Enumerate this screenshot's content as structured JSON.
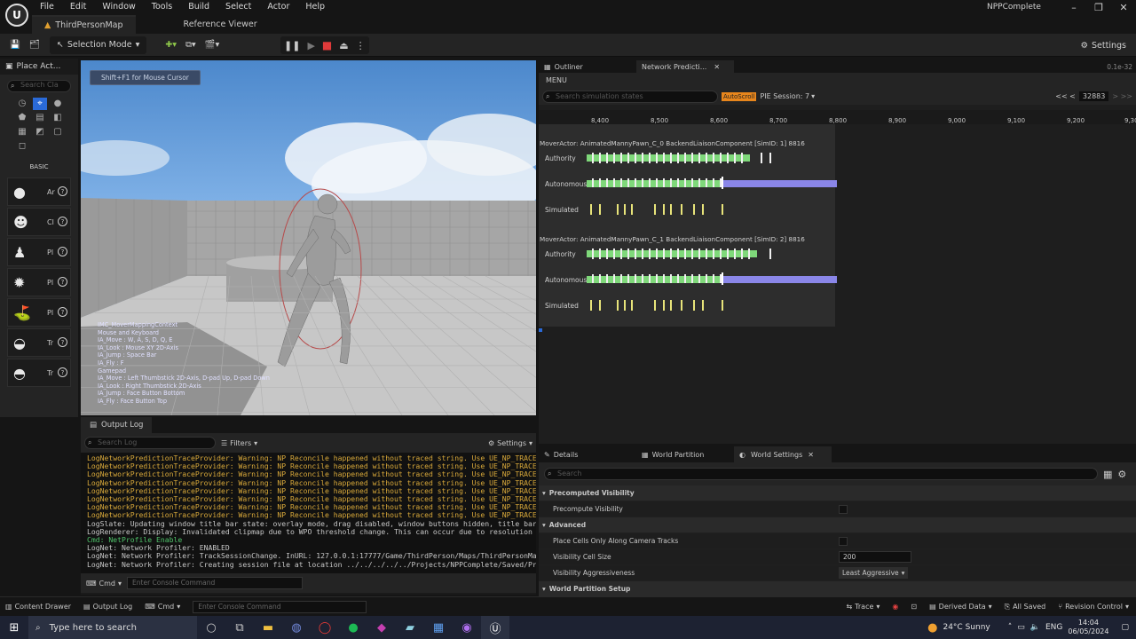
{
  "menu": [
    "File",
    "Edit",
    "Window",
    "Tools",
    "Build",
    "Select",
    "Actor",
    "Help"
  ],
  "project_name": "NPPComplete",
  "tabs": [
    "ThirdPersonMap",
    "Reference Viewer"
  ],
  "toolbar": {
    "selection_mode": "Selection Mode",
    "settings": "Settings"
  },
  "left_panel": {
    "title": "Place Act...",
    "search_placeholder": "Search Cla",
    "section": "BASIC",
    "items": [
      "Ar",
      "Cl",
      "Pl",
      "Pl",
      "Pl",
      "Tr",
      "Tr"
    ]
  },
  "viewport": {
    "hint": "Shift+F1 for Mouse Cursor",
    "overlay_lines": [
      "IMC_MoverMappingContext",
      "Mouse and Keyboard",
      "IA_Move : W, A, S, D, Q, E",
      "IA_Look : Mouse XY 2D-Axis",
      "IA_Jump : Space Bar",
      "IA_Fly : F",
      "Gamepad",
      "IA_Move : Left Thumbstick 2D-Axis, D-pad Up, D-pad Down",
      "IA_Look : Right Thumbstick 2D-Axis",
      "IA_Jump : Face Button Bottom",
      "IA_Fly : Face Button Top"
    ]
  },
  "output_log": {
    "title": "Output Log",
    "search_placeholder": "Search Log",
    "filters": "Filters",
    "settings": "Settings",
    "lines": [
      {
        "text": "LogNetworkPredictionTraceProvider: Warning: NP Reconcile happened without traced string. Use UE_NP_TRACE_",
        "color": "#d9a93a"
      },
      {
        "text": "LogNetworkPredictionTraceProvider: Warning: NP Reconcile happened without traced string. Use UE_NP_TRACE_",
        "color": "#d9a93a"
      },
      {
        "text": "LogNetworkPredictionTraceProvider: Warning: NP Reconcile happened without traced string. Use UE_NP_TRACE_",
        "color": "#d9a93a"
      },
      {
        "text": "LogNetworkPredictionTraceProvider: Warning: NP Reconcile happened without traced string. Use UE_NP_TRACE_",
        "color": "#d9a93a"
      },
      {
        "text": "LogNetworkPredictionTraceProvider: Warning: NP Reconcile happened without traced string. Use UE_NP_TRACE_",
        "color": "#d9a93a"
      },
      {
        "text": "LogNetworkPredictionTraceProvider: Warning: NP Reconcile happened without traced string. Use UE_NP_TRACE_",
        "color": "#d9a93a"
      },
      {
        "text": "LogNetworkPredictionTraceProvider: Warning: NP Reconcile happened without traced string. Use UE_NP_TRACE_",
        "color": "#d9a93a"
      },
      {
        "text": "LogNetworkPredictionTraceProvider: Warning: NP Reconcile happened without traced string. Use UE_NP_TRACE_",
        "color": "#d9a93a"
      },
      {
        "text": "LogSlate: Updating window title bar state: overlay mode, drag disabled, window buttons hidden, title bar",
        "color": "#c8c8c8"
      },
      {
        "text": "LogRenderer: Display: Invalidated clipmap due to WPO threshold change. This can occur due to resolution o",
        "color": "#c8c8c8"
      },
      {
        "text": "Cmd: NetProfile Enable",
        "color": "#4fc36a"
      },
      {
        "text": "LogNet: Network Profiler: ENABLED",
        "color": "#c8c8c8"
      },
      {
        "text": "LogNet: Network Profiler: TrackSessionChange.  InURL: 127.0.0.1:17777/Game/ThirdPerson/Maps/ThirdPersonMa",
        "color": "#c8c8c8"
      },
      {
        "text": "LogNet: Network Profiler: Creating session file at location ../../../../../Projects/NPPComplete/Saved/Pro",
        "color": "#c8c8c8"
      }
    ],
    "cmd": "Cmd",
    "console_placeholder": "Enter Console Command"
  },
  "npi": {
    "tabs": [
      "Outliner",
      "Network Predicti..."
    ],
    "menu": "MENU",
    "search_placeholder": "Search simulation states",
    "autoscroll": "AutoScroll",
    "session": "PIE Session: 7",
    "nav": "<< <",
    "frame": "32883",
    "nav_right": "> >>",
    "corner": "0.1e-32",
    "axis": [
      "8,400",
      "8,500",
      "8,600",
      "8,700",
      "8,800",
      "8,900",
      "9,000",
      "9,100",
      "9,200",
      "9,30"
    ],
    "groups": [
      {
        "title": "MoverActor: AnimatedMannyPawn_C_0 BackendLiaisonComponent [SimID: 1] 8816",
        "rows": [
          "Authority",
          "Autonomous",
          "Simulated"
        ]
      },
      {
        "title": "MoverActor: AnimatedMannyPawn_C_1 BackendLiaisonComponent [SimID: 2] 8816",
        "rows": [
          "Authority",
          "Autonomous",
          "Simulated"
        ]
      }
    ]
  },
  "details": {
    "tabs": [
      "Details",
      "World Partition",
      "World Settings"
    ],
    "search_placeholder": "Search",
    "rows": [
      {
        "label": "Precomputed Visibility",
        "kind": "section"
      },
      {
        "label": "Precompute Visibility",
        "kind": "check"
      },
      {
        "label": "Advanced",
        "kind": "section"
      },
      {
        "label": "Place Cells Only Along Camera Tracks",
        "kind": "check"
      },
      {
        "label": "Visibility Cell Size",
        "kind": "value",
        "value": "200"
      },
      {
        "label": "Visibility Aggressiveness",
        "kind": "dropdown",
        "value": "Least Aggressive"
      },
      {
        "label": "World Partition Setup",
        "kind": "section"
      }
    ]
  },
  "statusbar": {
    "content_drawer": "Content Drawer",
    "output_log": "Output Log",
    "cmd": "Cmd",
    "console_placeholder": "Enter Console Command",
    "trace": "Trace",
    "derived_data": "Derived Data",
    "all_saved": "All Saved",
    "revision_control": "Revision Control"
  },
  "taskbar": {
    "search": "Type here to search",
    "weather": "24°C  Sunny",
    "lang": "ENG",
    "time": "14:04",
    "date": "06/05/2024"
  }
}
